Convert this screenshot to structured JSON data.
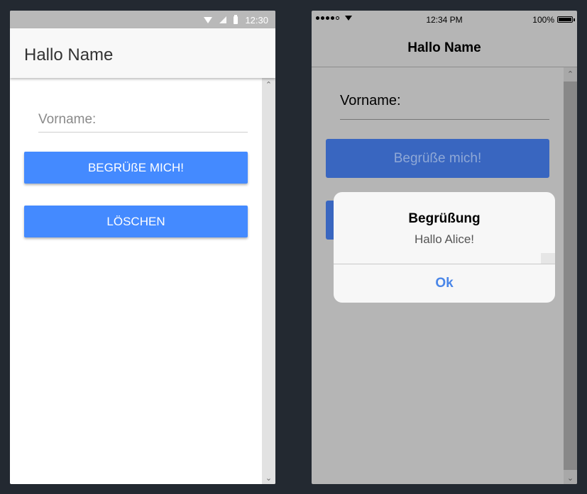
{
  "android": {
    "status": {
      "time": "12:30"
    },
    "appbar": {
      "title": "Hallo Name"
    },
    "form": {
      "first_name_placeholder": "Vorname:",
      "greet_button": "BEGRÜßE MICH!",
      "clear_button": "LÖSCHEN"
    },
    "icons": {
      "wifi": "wifi-icon",
      "signal": "signal-icon",
      "battery": "battery-icon",
      "scroll_up": "chevron-up-icon",
      "scroll_down": "chevron-down-icon"
    }
  },
  "ios": {
    "status": {
      "time": "12:34 PM",
      "battery": "100%"
    },
    "navbar": {
      "title": "Hallo Name"
    },
    "form": {
      "first_name_label": "Vorname:",
      "greet_button": "Begrüße mich!"
    },
    "alert": {
      "title": "Begrüßung",
      "message": "Hallo Alice!",
      "ok_button": "Ok"
    },
    "icons": {
      "wifi": "wifi-icon",
      "battery": "battery-icon",
      "signal_dots": "signal-dots-icon"
    }
  },
  "colors": {
    "android_accent": "#448aff",
    "ios_button": "#3966c0",
    "ios_alert_action": "#4a86e8",
    "background": "#232931"
  }
}
